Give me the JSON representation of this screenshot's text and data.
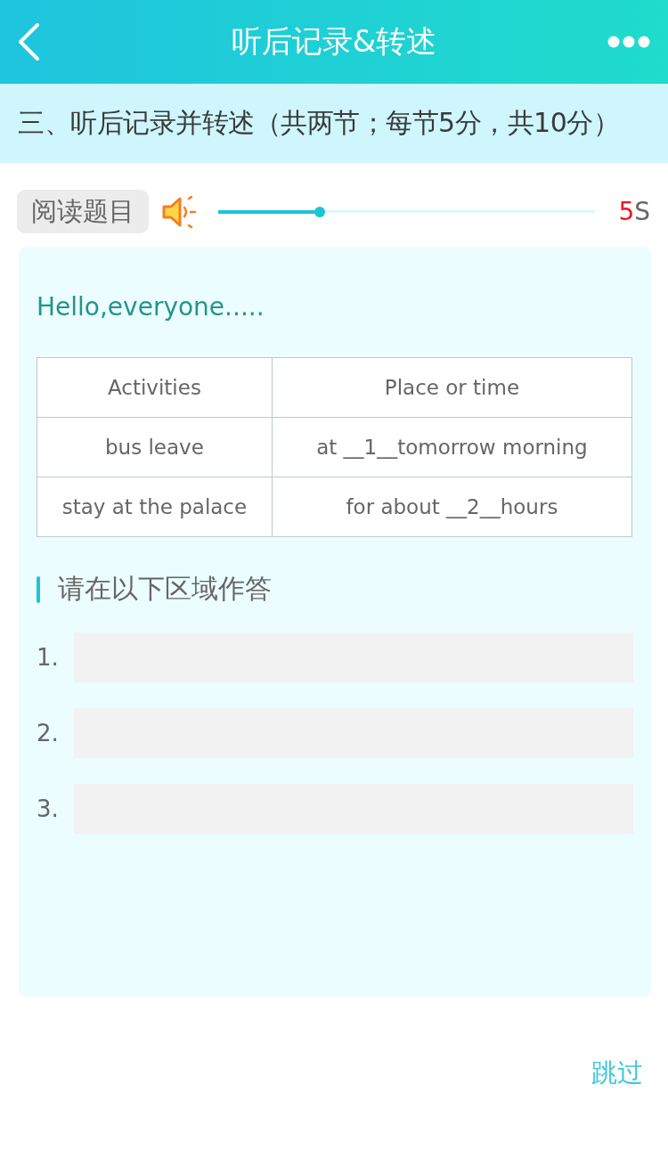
{
  "header": {
    "title": "听后记录&转述"
  },
  "section_title": "三、听后记录并转述（共两节；每节5分，共10分）",
  "audio": {
    "button": "阅读题目",
    "level": 0.27,
    "countdown": {
      "number": "5",
      "unit": "S"
    }
  },
  "passage": {
    "intro": "Hello,everyone.....",
    "table": {
      "columns": [
        "Activities",
        "Place or time"
      ],
      "rows": [
        [
          "bus leave",
          "at __1__tomorrow morning"
        ],
        [
          "stay at the palace",
          "for about __2__hours"
        ]
      ]
    }
  },
  "answer_section": {
    "heading": "请在以下区域作答",
    "answers": [
      {
        "number": "1."
      },
      {
        "number": "2."
      },
      {
        "number": "3."
      }
    ]
  },
  "footer": {
    "skip": "跳过"
  }
}
